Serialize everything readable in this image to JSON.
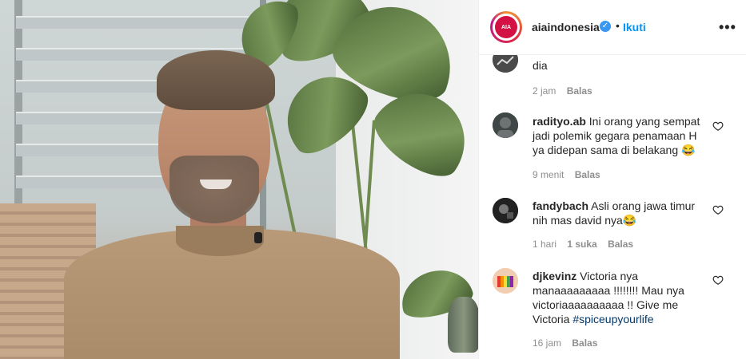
{
  "post": {
    "username": "aiaindonesia",
    "follow_label": "Ikuti",
    "dot": "•",
    "more_label": "•••",
    "logo_text": "AIA"
  },
  "comments": [
    {
      "username": "",
      "text": "dia",
      "time": "2 jam",
      "likes": "",
      "reply_label": "Balas"
    },
    {
      "username": "radityo.ab",
      "text": "Ini orang yang sempat jadi polemik gegara penamaan H ya didepan sama di belakang 😂",
      "time": "9 menit",
      "likes": "",
      "reply_label": "Balas"
    },
    {
      "username": "fandybach",
      "text": "Asli orang jawa timur nih mas david nya😂",
      "time": "1 hari",
      "likes": "1 suka",
      "reply_label": "Balas"
    },
    {
      "username": "djkevinz",
      "text": "Victoria nya manaaaaaaaaa !!!!!!!! Mau nya victoriaaaaaaaaaa !! Give me Victoria ",
      "hashtag": "#spiceupyourlife",
      "time": "16 jam",
      "likes": "",
      "reply_label": "Balas"
    }
  ],
  "colors": {
    "link": "#0095f6",
    "text": "#262626",
    "muted": "#8e8e8e",
    "brand": "#d31145"
  },
  "icons": [
    "verified-badge-icon",
    "more-options-icon",
    "heart-icon"
  ]
}
